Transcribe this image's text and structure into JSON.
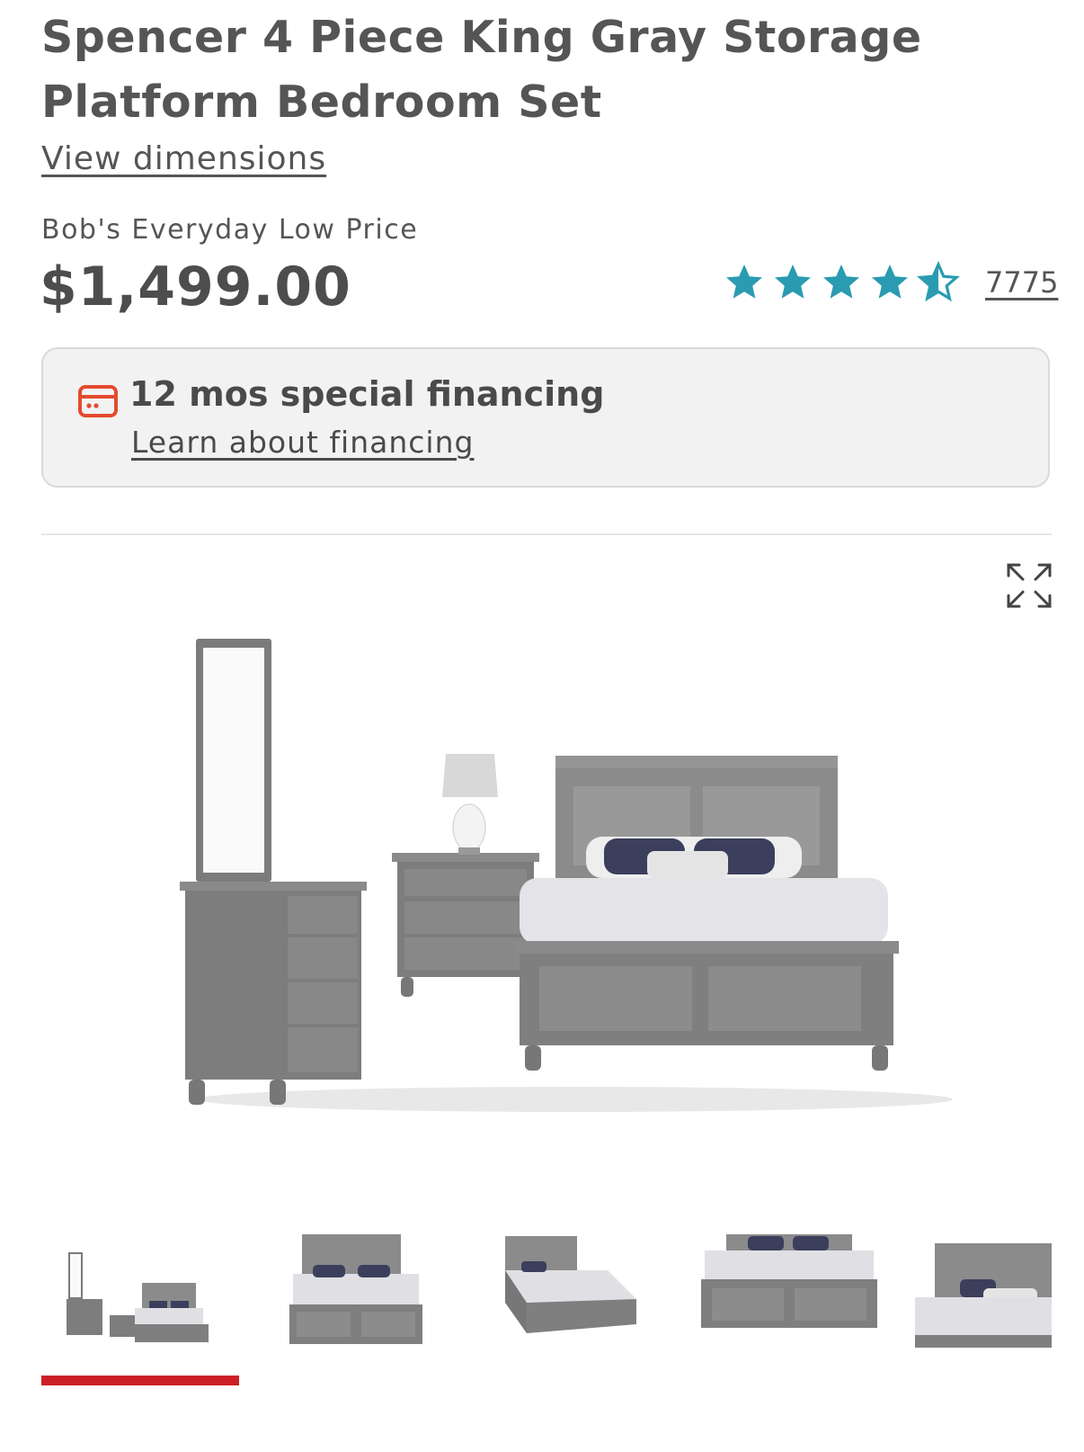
{
  "product": {
    "title": "Spencer 4 Piece King Gray Storage Platform Bedroom Set",
    "dimensions_link": "View dimensions",
    "price_label": "Bob's Everyday Low Price",
    "price": "$1,499.00",
    "rating": {
      "stars": 4.5,
      "max": 5,
      "review_count": "7775",
      "color": "#2a9bb0"
    }
  },
  "financing": {
    "title": "12 mos special financing",
    "link": "Learn about financing",
    "icon": "credit-card-icon",
    "icon_color": "#e54a2f"
  },
  "gallery": {
    "expand_icon": "expand-icon",
    "thumbnails": [
      {
        "name": "full-set",
        "active": true
      },
      {
        "name": "bed-front"
      },
      {
        "name": "bed-angle"
      },
      {
        "name": "bed-footboard"
      },
      {
        "name": "bed-closeup"
      }
    ],
    "active_color": "#cc1f26"
  }
}
